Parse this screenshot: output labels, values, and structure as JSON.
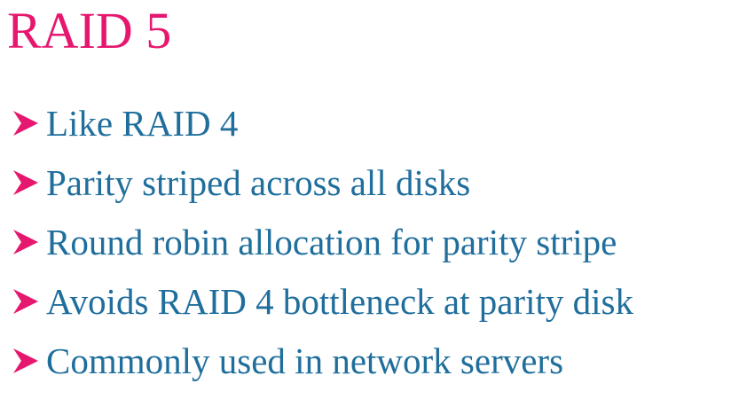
{
  "slide": {
    "title": "RAID 5",
    "bullet_icon": "arrowhead-bullet-icon",
    "colors": {
      "title": "#e6176e",
      "bullet_marker": "#e6176e",
      "bullet_text": "#1f6e9c"
    },
    "bullets": [
      "Like RAID 4",
      "Parity striped across all disks",
      "Round robin allocation for parity stripe",
      "Avoids RAID 4 bottleneck at parity disk",
      "Commonly used in network servers"
    ]
  }
}
